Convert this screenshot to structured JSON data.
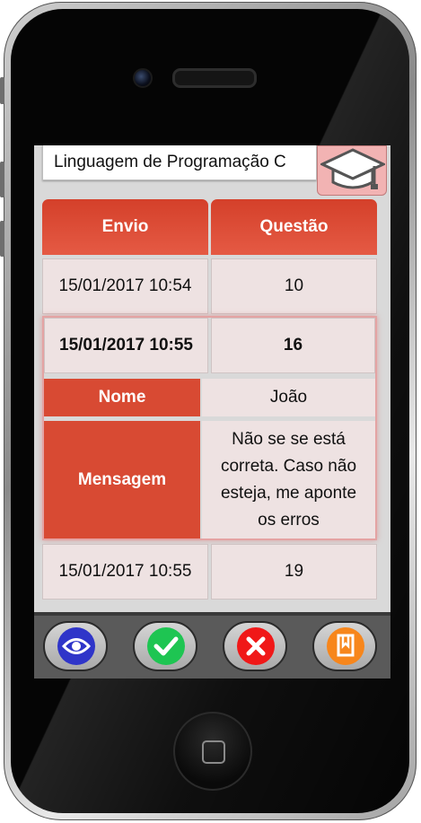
{
  "course": {
    "title": "Linguagem de Programação C",
    "icon": "graduation-cap-icon"
  },
  "table": {
    "headers": {
      "envio": "Envio",
      "questao": "Questão"
    },
    "rows": [
      {
        "envio": "15/01/2017 10:54",
        "questao": "10"
      },
      {
        "envio": "15/01/2017 10:55",
        "questao": "16"
      },
      {
        "envio": "15/01/2017 10:55",
        "questao": "19"
      }
    ],
    "selected": {
      "nome_label": "Nome",
      "nome_value": "João",
      "mensagem_label": "Mensagem",
      "mensagem_value": "Não se se está correta. Caso não esteja, me aponte os erros"
    }
  },
  "actions": [
    {
      "name": "view",
      "icon": "eye-icon",
      "color": "#2f35c9"
    },
    {
      "name": "approve",
      "icon": "check-icon",
      "color": "#1ec552"
    },
    {
      "name": "reject",
      "icon": "close-icon",
      "color": "#f01818"
    },
    {
      "name": "book",
      "icon": "book-icon",
      "color": "#f7861b"
    }
  ],
  "colors": {
    "header_red": "#d84a33",
    "cell_bg": "#eee2e2"
  }
}
